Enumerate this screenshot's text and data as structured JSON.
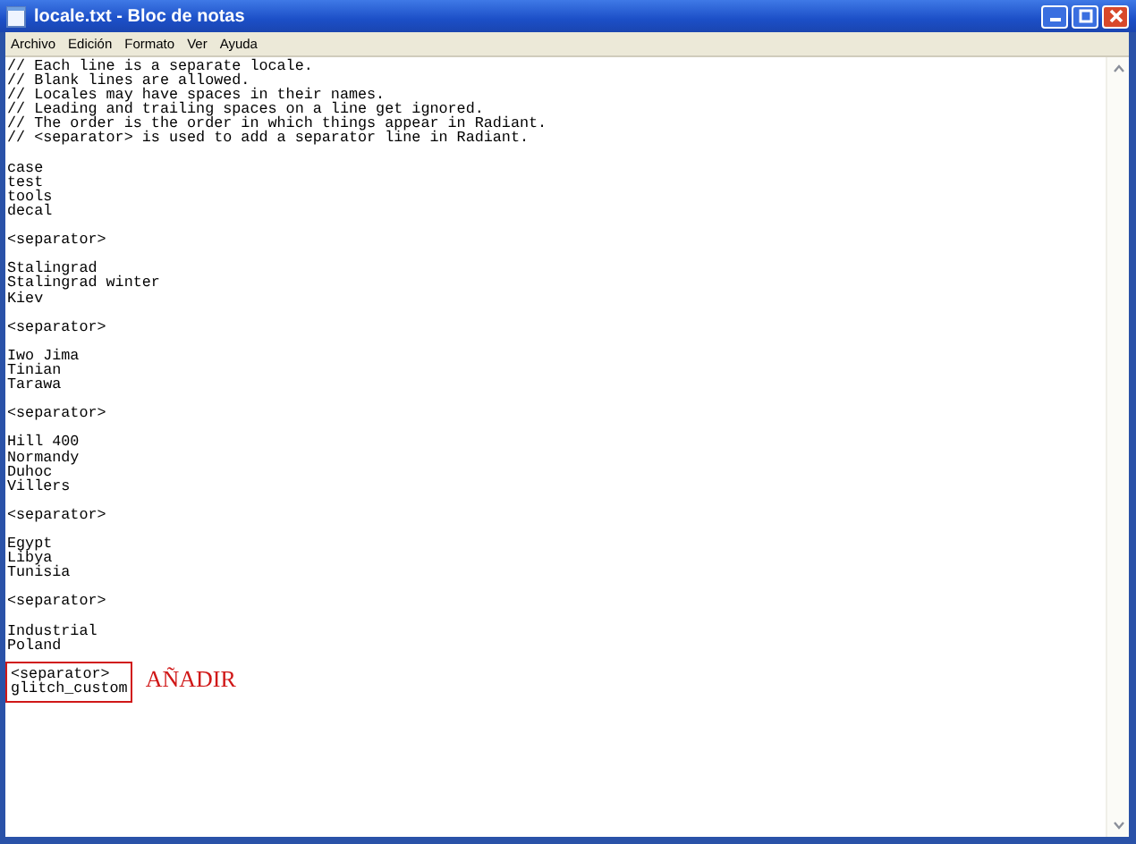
{
  "window": {
    "title": "locale.txt - Bloc de notas"
  },
  "menu": [
    "Archivo",
    "Edición",
    "Formato",
    "Ver",
    "Ayuda"
  ],
  "blocks": [
    {
      "lines": [
        "// Each line is a separate locale.",
        "// Blank lines are allowed.",
        "// Locales may have spaces in their names.",
        "// Leading and trailing spaces on a line get ignored.",
        "// The order is the order in which things appear in Radiant.",
        "// <separator> is used to add a separator line in Radiant."
      ]
    },
    {
      "lines": [
        "case",
        "test",
        "tools",
        "decal"
      ]
    },
    {
      "lines": [
        "<separator>"
      ]
    },
    {
      "lines": [
        "Stalingrad",
        "Stalingrad winter",
        "Kiev"
      ]
    },
    {
      "lines": [
        "<separator>"
      ]
    },
    {
      "lines": [
        "Iwo Jima",
        "Tinian",
        "Tarawa"
      ]
    },
    {
      "lines": [
        "<separator>"
      ]
    },
    {
      "lines": [
        "Hill 400",
        "Normandy",
        "Duhoc",
        "Villers"
      ]
    },
    {
      "lines": [
        "<separator>"
      ]
    },
    {
      "lines": [
        "Egypt",
        "Libya",
        "Tunisia"
      ]
    },
    {
      "lines": [
        "<separator>"
      ]
    },
    {
      "lines": [
        "Industrial",
        "Poland"
      ]
    },
    {
      "lines": [
        "<separator>",
        "glitch_custom"
      ],
      "highlighted": true,
      "annotation": "AÑADIR"
    }
  ]
}
